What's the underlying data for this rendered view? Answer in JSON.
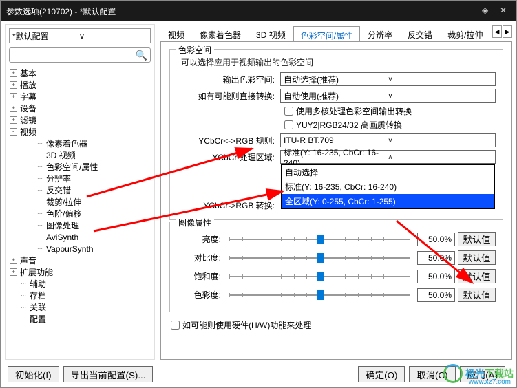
{
  "title": "参数选项(210702) - *默认配置",
  "preset_dropdown": "*默认配置",
  "tree": [
    {
      "icon": "+",
      "ind": 0,
      "label": "基本"
    },
    {
      "icon": "+",
      "ind": 0,
      "label": "播放"
    },
    {
      "icon": "+",
      "ind": 0,
      "label": "字幕"
    },
    {
      "icon": "+",
      "ind": 0,
      "label": "设备"
    },
    {
      "icon": "+",
      "ind": 0,
      "label": "滤镜"
    },
    {
      "icon": "-",
      "ind": 0,
      "label": "视频"
    },
    {
      "ind": 2,
      "label": "像素着色器"
    },
    {
      "ind": 2,
      "label": "3D 视频"
    },
    {
      "ind": 2,
      "label": "色彩空间/属性"
    },
    {
      "ind": 2,
      "label": "分辨率"
    },
    {
      "ind": 2,
      "label": "反交错"
    },
    {
      "ind": 2,
      "label": "裁剪/拉伸"
    },
    {
      "ind": 2,
      "label": "色阶/偏移"
    },
    {
      "ind": 2,
      "label": "图像处理"
    },
    {
      "ind": 2,
      "label": "AviSynth"
    },
    {
      "ind": 2,
      "label": "VapourSynth"
    },
    {
      "icon": "+",
      "ind": 0,
      "label": "声音"
    },
    {
      "icon": "+",
      "ind": 0,
      "label": "扩展功能"
    },
    {
      "ind": 1,
      "label": "辅助"
    },
    {
      "ind": 1,
      "label": "存档"
    },
    {
      "ind": 1,
      "label": "关联"
    },
    {
      "ind": 1,
      "label": "配置"
    }
  ],
  "tabs": [
    "视频",
    "像素着色器",
    "3D 视频",
    "色彩空间/属性",
    "分辨率",
    "反交错",
    "裁剪/拉伸"
  ],
  "active_tab": 3,
  "group1": {
    "title": "色彩空间",
    "desc": "可以选择应用于视频输出的色彩空间",
    "out_label": "输出色彩空间:",
    "out_value": "自动选择(推荐)",
    "conv_label": "如有可能则直接转换:",
    "conv_value": "自动使用(推荐)",
    "chk1": "使用多核处理色彩空间输出转换",
    "chk2": "YUY2|RGB24/32 高画质转换",
    "rule_label": "YCbCr<->RGB 规则:",
    "rule_value": "ITU-R BT.709",
    "range_label": "YCbCr 处理区域:",
    "range_value": "标准(Y: 16-235, CbCr: 16-240)",
    "torb_label": "YCbCr->RGB 转换:",
    "dd_items": [
      "自动选择",
      "标准(Y: 16-235, CbCr: 16-240)",
      "全区域(Y: 0-255, CbCr: 1-255)"
    ]
  },
  "group2": {
    "title": "图像属性",
    "rows": [
      {
        "label": "亮度:",
        "val": "50.0%"
      },
      {
        "label": "对比度:",
        "val": "50.0%"
      },
      {
        "label": "饱和度:",
        "val": "50.0%"
      },
      {
        "label": "色彩度:",
        "val": "50.0%"
      }
    ],
    "default_btn": "默认值"
  },
  "hw_check": "如可能则使用硬件(H/W)功能来处理",
  "footer": {
    "init": "初始化(I)",
    "export": "导出当前配置(S)...",
    "ok": "确定(O)",
    "cancel": "取消(C)",
    "apply": "应用(A)"
  },
  "watermark": {
    "brand1": "极光",
    "brand2": "下载站",
    "url": "www.xz7.com"
  }
}
